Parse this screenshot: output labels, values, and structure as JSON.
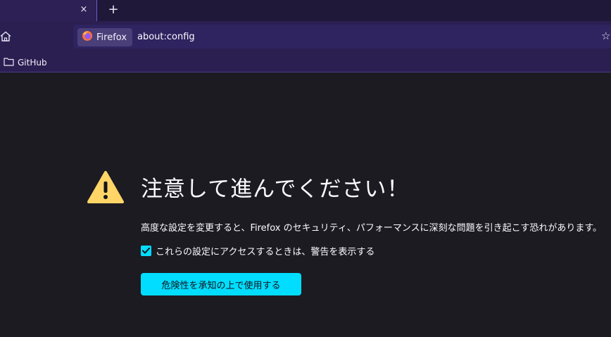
{
  "tabs": {
    "close_glyph": "×",
    "new_tab_glyph": "+"
  },
  "urlbar": {
    "identity_label": "Firefox",
    "url": "about:config",
    "star_glyph": "☆"
  },
  "bookmarks": {
    "items": [
      {
        "label": "GitHub",
        "icon": "folder-icon"
      }
    ]
  },
  "warning": {
    "title": "注意して進んでください！",
    "description": "高度な設定を変更すると、Firefox のセキュリティ、パフォーマンスに深刻な問題を引き起こす恐れがあります。",
    "checkbox_label": "これらの設定にアクセスするときは、警告を表示する",
    "checkbox_checked": true,
    "accept_button": "危険性を承知の上で使用する"
  },
  "colors": {
    "accent": "#00ddff",
    "warning_icon": "#ffd567",
    "chrome_bg": "#2b1f52",
    "page_bg": "#1c1b22"
  }
}
